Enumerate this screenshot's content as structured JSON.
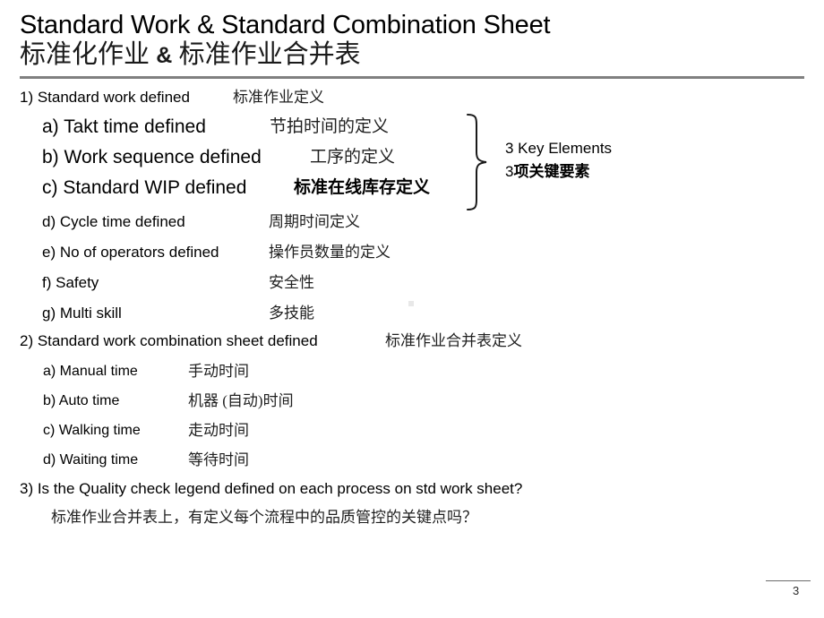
{
  "title": {
    "english": "Standard Work & Standard Combination Sheet",
    "chinese_pre": "标准化作业",
    "chinese_amp": "&",
    "chinese_post": "标准作业合并表"
  },
  "sections": [
    {
      "number": "1)",
      "heading_en": "1) Standard work defined",
      "heading_cn": "标准作业定义",
      "items": [
        {
          "en": "a) Takt time defined",
          "cn": "节拍时间的定义",
          "emphasis": "large"
        },
        {
          "en": "b) Work sequence defined",
          "cn": "工序的定义",
          "emphasis": "large"
        },
        {
          "en": "c) Standard WIP defined",
          "cn": "标准在线库存定义",
          "emphasis": "large-bold-cn"
        },
        {
          "en": "d) Cycle time defined",
          "cn": "周期时间定义",
          "emphasis": "normal"
        },
        {
          "en": "e) No of operators defined",
          "cn": "操作员数量的定义",
          "emphasis": "normal"
        },
        {
          "en": "f) Safety",
          "cn": "安全性",
          "emphasis": "normal"
        },
        {
          "en": "g) Multi skill",
          "cn": "多技能",
          "emphasis": "normal"
        }
      ]
    },
    {
      "number": "2)",
      "heading_en": "2) Standard work combination sheet defined",
      "heading_cn": "标准作业合并表定义",
      "items": [
        {
          "en": "a) Manual time",
          "cn": "手动时间",
          "emphasis": "normal"
        },
        {
          "en": "b) Auto time",
          "cn": "机器 (自动)时间",
          "emphasis": "normal"
        },
        {
          "en": "c) Walking time",
          "cn": "走动时间",
          "emphasis": "normal"
        },
        {
          "en": "d) Waiting time",
          "cn": "等待时间",
          "emphasis": "normal"
        }
      ]
    },
    {
      "number": "3)",
      "heading_en": "3) Is the Quality check legend defined on each process on std work sheet?",
      "heading_cn": "标准作业合并表上，有定义每个流程中的品质管控的关键点吗？",
      "items": []
    }
  ],
  "callout": {
    "brace_icon": "right-curly-brace-icon",
    "english": "3 Key Elements",
    "chinese_number": "3",
    "chinese_text": "项关键要素"
  },
  "footer": {
    "page_number": "3"
  },
  "colors": {
    "rule": "#808080",
    "text": "#000000",
    "chinese_text": "#1f1f1f",
    "background": "#ffffff"
  }
}
